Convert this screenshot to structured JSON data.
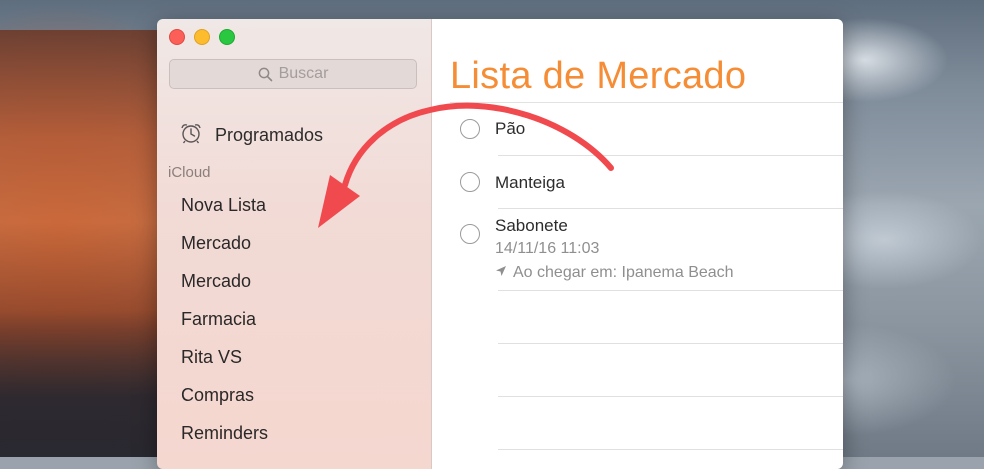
{
  "sidebar": {
    "search_placeholder": "Buscar",
    "scheduled_label": "Programados",
    "section_label": "iCloud",
    "lists": [
      "Nova Lista",
      "Mercado",
      "Mercado",
      "Farmacia",
      "Rita VS",
      "Compras",
      "Reminders"
    ]
  },
  "main": {
    "title": "Lista de Mercado",
    "add_label": "+",
    "items": [
      {
        "title": "Pão"
      },
      {
        "title": "Manteiga"
      },
      {
        "title": "Sabonete",
        "date": "14/11/16 11:03",
        "location": "Ao chegar em: Ipanema Beach"
      }
    ]
  },
  "colors": {
    "accent": "#f58d36",
    "annotation": "#f04a4f"
  }
}
